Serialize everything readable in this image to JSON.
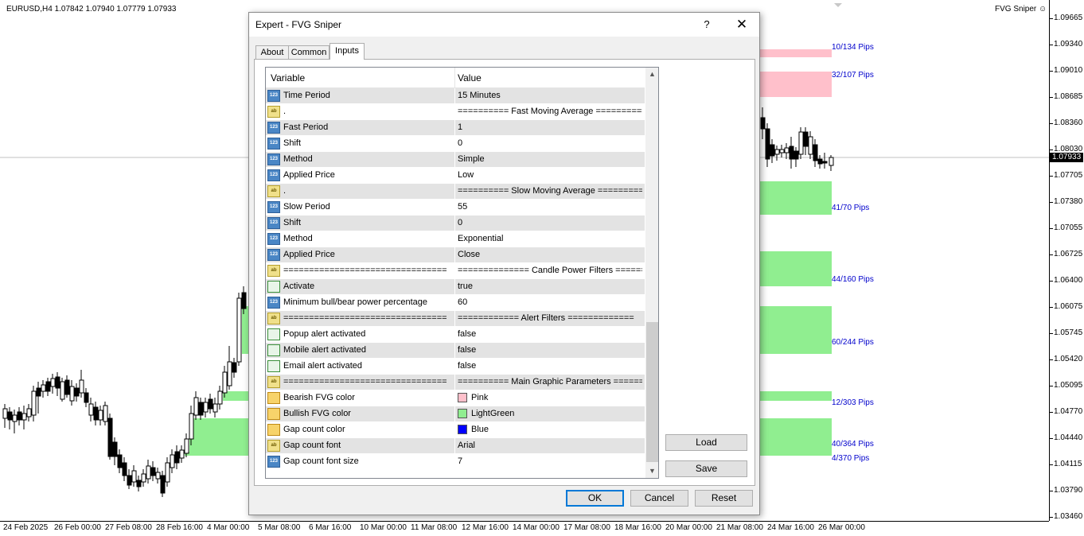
{
  "chart": {
    "symbol_info": "EURUSD,H4  1.07842 1.07940 1.07779 1.07933",
    "expert_name": "FVG Sniper",
    "current_price": "1.07933",
    "price_axis": [
      "1.09665",
      "1.09340",
      "1.09010",
      "1.08685",
      "1.08360",
      "1.08030",
      "1.07705",
      "1.07380",
      "1.07055",
      "1.06725",
      "1.06400",
      "1.06075",
      "1.05745",
      "1.05420",
      "1.05095",
      "1.04770",
      "1.04440",
      "1.04115",
      "1.03790",
      "1.03460"
    ],
    "time_axis": [
      "24 Feb 2025",
      "26 Feb 00:00",
      "27 Feb 08:00",
      "28 Feb 16:00",
      "4 Mar 00:00",
      "5 Mar 08:00",
      "6 Mar 16:00",
      "10 Mar 00:00",
      "11 Mar 08:00",
      "12 Mar 16:00",
      "14 Mar 00:00",
      "17 Mar 08:00",
      "18 Mar 16:00",
      "20 Mar 00:00",
      "21 Mar 08:00",
      "24 Mar 16:00",
      "26 Mar 00:00"
    ],
    "pip_labels": [
      "10/134 Pips",
      "32/107 Pips",
      "41/70 Pips",
      "44/160 Pips",
      "60/244 Pips",
      "12/303 Pips",
      "40/364 Pips",
      "4/370 Pips"
    ],
    "colors": {
      "bearish_fvg": "#ffc0cb",
      "bullish_fvg": "#90ee90",
      "pips_text": "#0000cc"
    }
  },
  "dialog": {
    "title": "Expert - FVG Sniper",
    "help_label": "?",
    "close_label": "✕",
    "tabs": [
      {
        "label": "About"
      },
      {
        "label": "Common"
      },
      {
        "label": "Inputs"
      }
    ],
    "active_tab": "Inputs",
    "grid": {
      "col_variable": "Variable",
      "col_value": "Value",
      "rows": [
        {
          "type": "num",
          "variable": "Time Period",
          "value": "15 Minutes"
        },
        {
          "type": "str",
          "variable": ".",
          "value": "========== Fast Moving Average =========="
        },
        {
          "type": "num",
          "variable": "Fast Period",
          "value": "1"
        },
        {
          "type": "num",
          "variable": "Shift",
          "value": "0"
        },
        {
          "type": "num",
          "variable": "Method",
          "value": "Simple"
        },
        {
          "type": "num",
          "variable": "Applied Price",
          "value": "Low"
        },
        {
          "type": "str",
          "variable": ".",
          "value": "========== Slow Moving Average =========="
        },
        {
          "type": "num",
          "variable": "Slow Period",
          "value": "55"
        },
        {
          "type": "num",
          "variable": "Shift",
          "value": "0"
        },
        {
          "type": "num",
          "variable": "Method",
          "value": "Exponential"
        },
        {
          "type": "num",
          "variable": "Applied Price",
          "value": "Close"
        },
        {
          "type": "str",
          "variable": "================================",
          "value": "============== Candle Power Filters ======..."
        },
        {
          "type": "bool",
          "variable": "Activate",
          "value": "true"
        },
        {
          "type": "num",
          "variable": "Minimum bull/bear power percentage",
          "value": "60"
        },
        {
          "type": "str",
          "variable": "================================",
          "value": "============ Alert Filters ============="
        },
        {
          "type": "bool",
          "variable": "Popup alert activated",
          "value": "false"
        },
        {
          "type": "bool",
          "variable": "Mobile alert activated",
          "value": "false"
        },
        {
          "type": "bool",
          "variable": "Email alert activated",
          "value": "false"
        },
        {
          "type": "str",
          "variable": "================================",
          "value": "========== Main Graphic Parameters ======..."
        },
        {
          "type": "color",
          "variable": "Bearish FVG color",
          "value": "Pink",
          "swatch": "#ffc0cb"
        },
        {
          "type": "color",
          "variable": "Bullish FVG color",
          "value": "LightGreen",
          "swatch": "#90ee90"
        },
        {
          "type": "color",
          "variable": "Gap count color",
          "value": "Blue",
          "swatch": "#0000ff"
        },
        {
          "type": "str",
          "variable": "Gap count font",
          "value": "Arial"
        },
        {
          "type": "num",
          "variable": "Gap count font size",
          "value": "7"
        }
      ]
    },
    "buttons": {
      "load": "Load",
      "save": "Save",
      "ok": "OK",
      "cancel": "Cancel",
      "reset": "Reset"
    }
  }
}
